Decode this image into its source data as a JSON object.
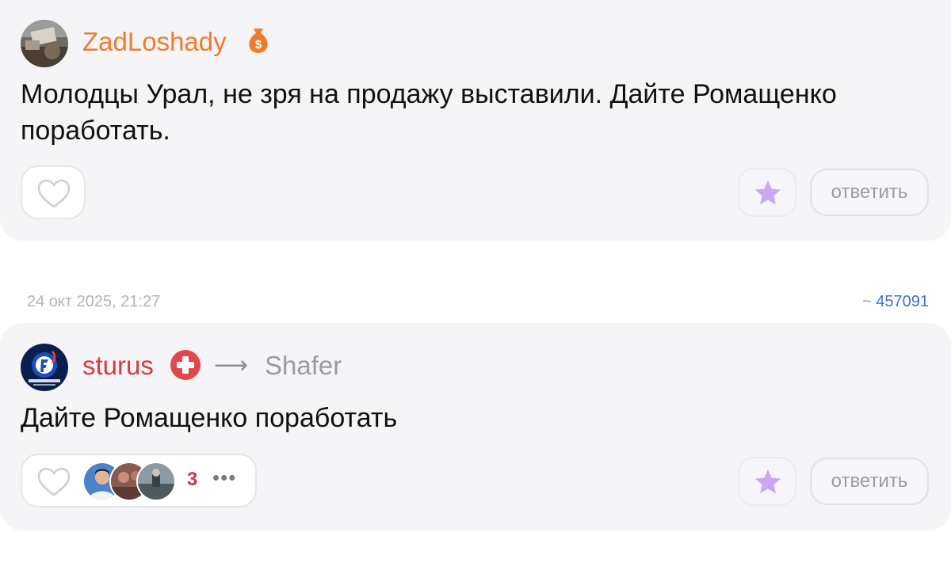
{
  "comment1": {
    "author": "ZadLoshady",
    "badge_icon": "money-bag-icon",
    "text": "Молодцы Урал, не зря на продажу выставили. Дайте Ромащенко поработать.",
    "reply_label": "ответить",
    "colors": {
      "author": "#f07b2c",
      "badge": "#f07b2c"
    }
  },
  "meta": {
    "date": "24 окт 2025, 21:27",
    "id_prefix": "~",
    "id": "457091"
  },
  "comment2": {
    "author": "sturus",
    "badge_icon": "red-cross-icon",
    "arrow": "⟶",
    "recipient": "Shafer",
    "text": "Дайте Ромащенко поработать",
    "reaction_count": "3",
    "more": "•••",
    "reply_label": "ответить",
    "colors": {
      "author": "#d83c3c",
      "badge": "#e2474b",
      "count": "#d8333a"
    }
  },
  "colors": {
    "star": "#c9a8f2",
    "link": "#3b6fd1"
  }
}
